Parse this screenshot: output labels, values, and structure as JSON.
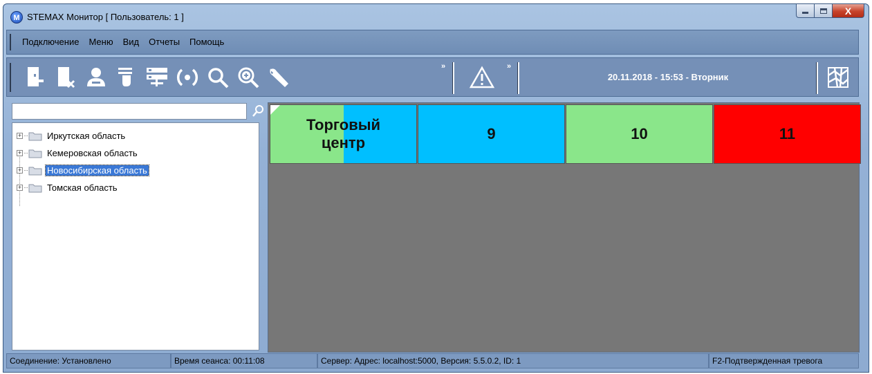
{
  "window": {
    "title": "STEMAX Монитор [ Пользователь: 1 ]",
    "app_icon_letter": "M",
    "close_glyph": "X"
  },
  "menu": {
    "items": [
      "Подключение",
      "Меню",
      "Вид",
      "Отчеты",
      "Помощь"
    ]
  },
  "toolbar": {
    "buttons": [
      {
        "icon": "connect-icon"
      },
      {
        "icon": "disconnect-icon"
      },
      {
        "icon": "user-icon"
      },
      {
        "icon": "select-object-icon"
      },
      {
        "icon": "server-icon"
      },
      {
        "icon": "refresh-signal-icon"
      },
      {
        "icon": "search-icon"
      },
      {
        "icon": "zoom-in-icon"
      },
      {
        "icon": "wrench-icon"
      }
    ],
    "overflow_glyph": "»",
    "datetime": "20.11.2018 - 15:53 - Вторник"
  },
  "tree": {
    "search_value": "",
    "items": [
      {
        "label": "Иркутская область",
        "selected": false
      },
      {
        "label": "Кемеровская область",
        "selected": false
      },
      {
        "label": "Новосибирская область",
        "selected": true
      },
      {
        "label": "Томская область",
        "selected": false
      }
    ]
  },
  "tiles": [
    {
      "label": "Торговый\nцентр",
      "colors": [
        "#8ae68a",
        "#00bfff"
      ],
      "flagged": true
    },
    {
      "label": "9",
      "colors": [
        "#00bfff"
      ]
    },
    {
      "label": "10",
      "colors": [
        "#8ae68a"
      ]
    },
    {
      "label": "11",
      "colors": [
        "#ff0000"
      ]
    }
  ],
  "status": {
    "connection": "Соединение: Установлено",
    "session": "Время сеанса: 00:11:08",
    "server": "Сервер: Адрес: localhost:5000, Версия: 5.5.0.2, ID: 1",
    "hint": "F2-Подтвержденная тревога"
  }
}
